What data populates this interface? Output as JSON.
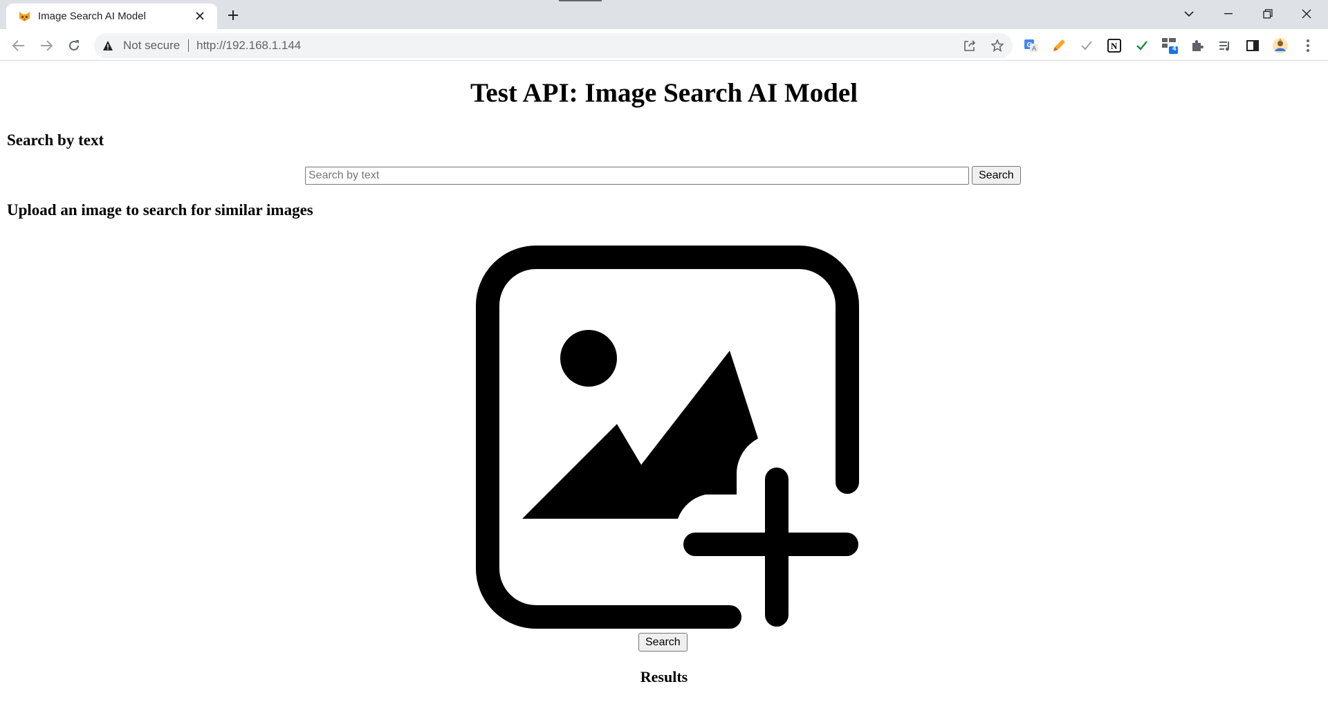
{
  "browser": {
    "tab": {
      "title": "Image Search AI Model"
    },
    "omnibox": {
      "security_label": "Not secure",
      "url": "http://192.168.1.144"
    },
    "extensions": {
      "badge_count": "4"
    }
  },
  "page": {
    "title": "Test API: Image Search AI Model",
    "text_search": {
      "heading": "Search by text",
      "placeholder": "Search by text",
      "value": "",
      "button_label": "Search"
    },
    "image_search": {
      "heading": "Upload an image to search for similar images",
      "upload_icon": "add-image-icon",
      "button_label": "Search"
    },
    "results": {
      "heading": "Results"
    }
  },
  "colors": {
    "tabstrip_bg": "#dee1e6",
    "omnibox_bg": "#f1f3f4",
    "chrome_icon": "#5f6368",
    "page_text": "#000000"
  }
}
